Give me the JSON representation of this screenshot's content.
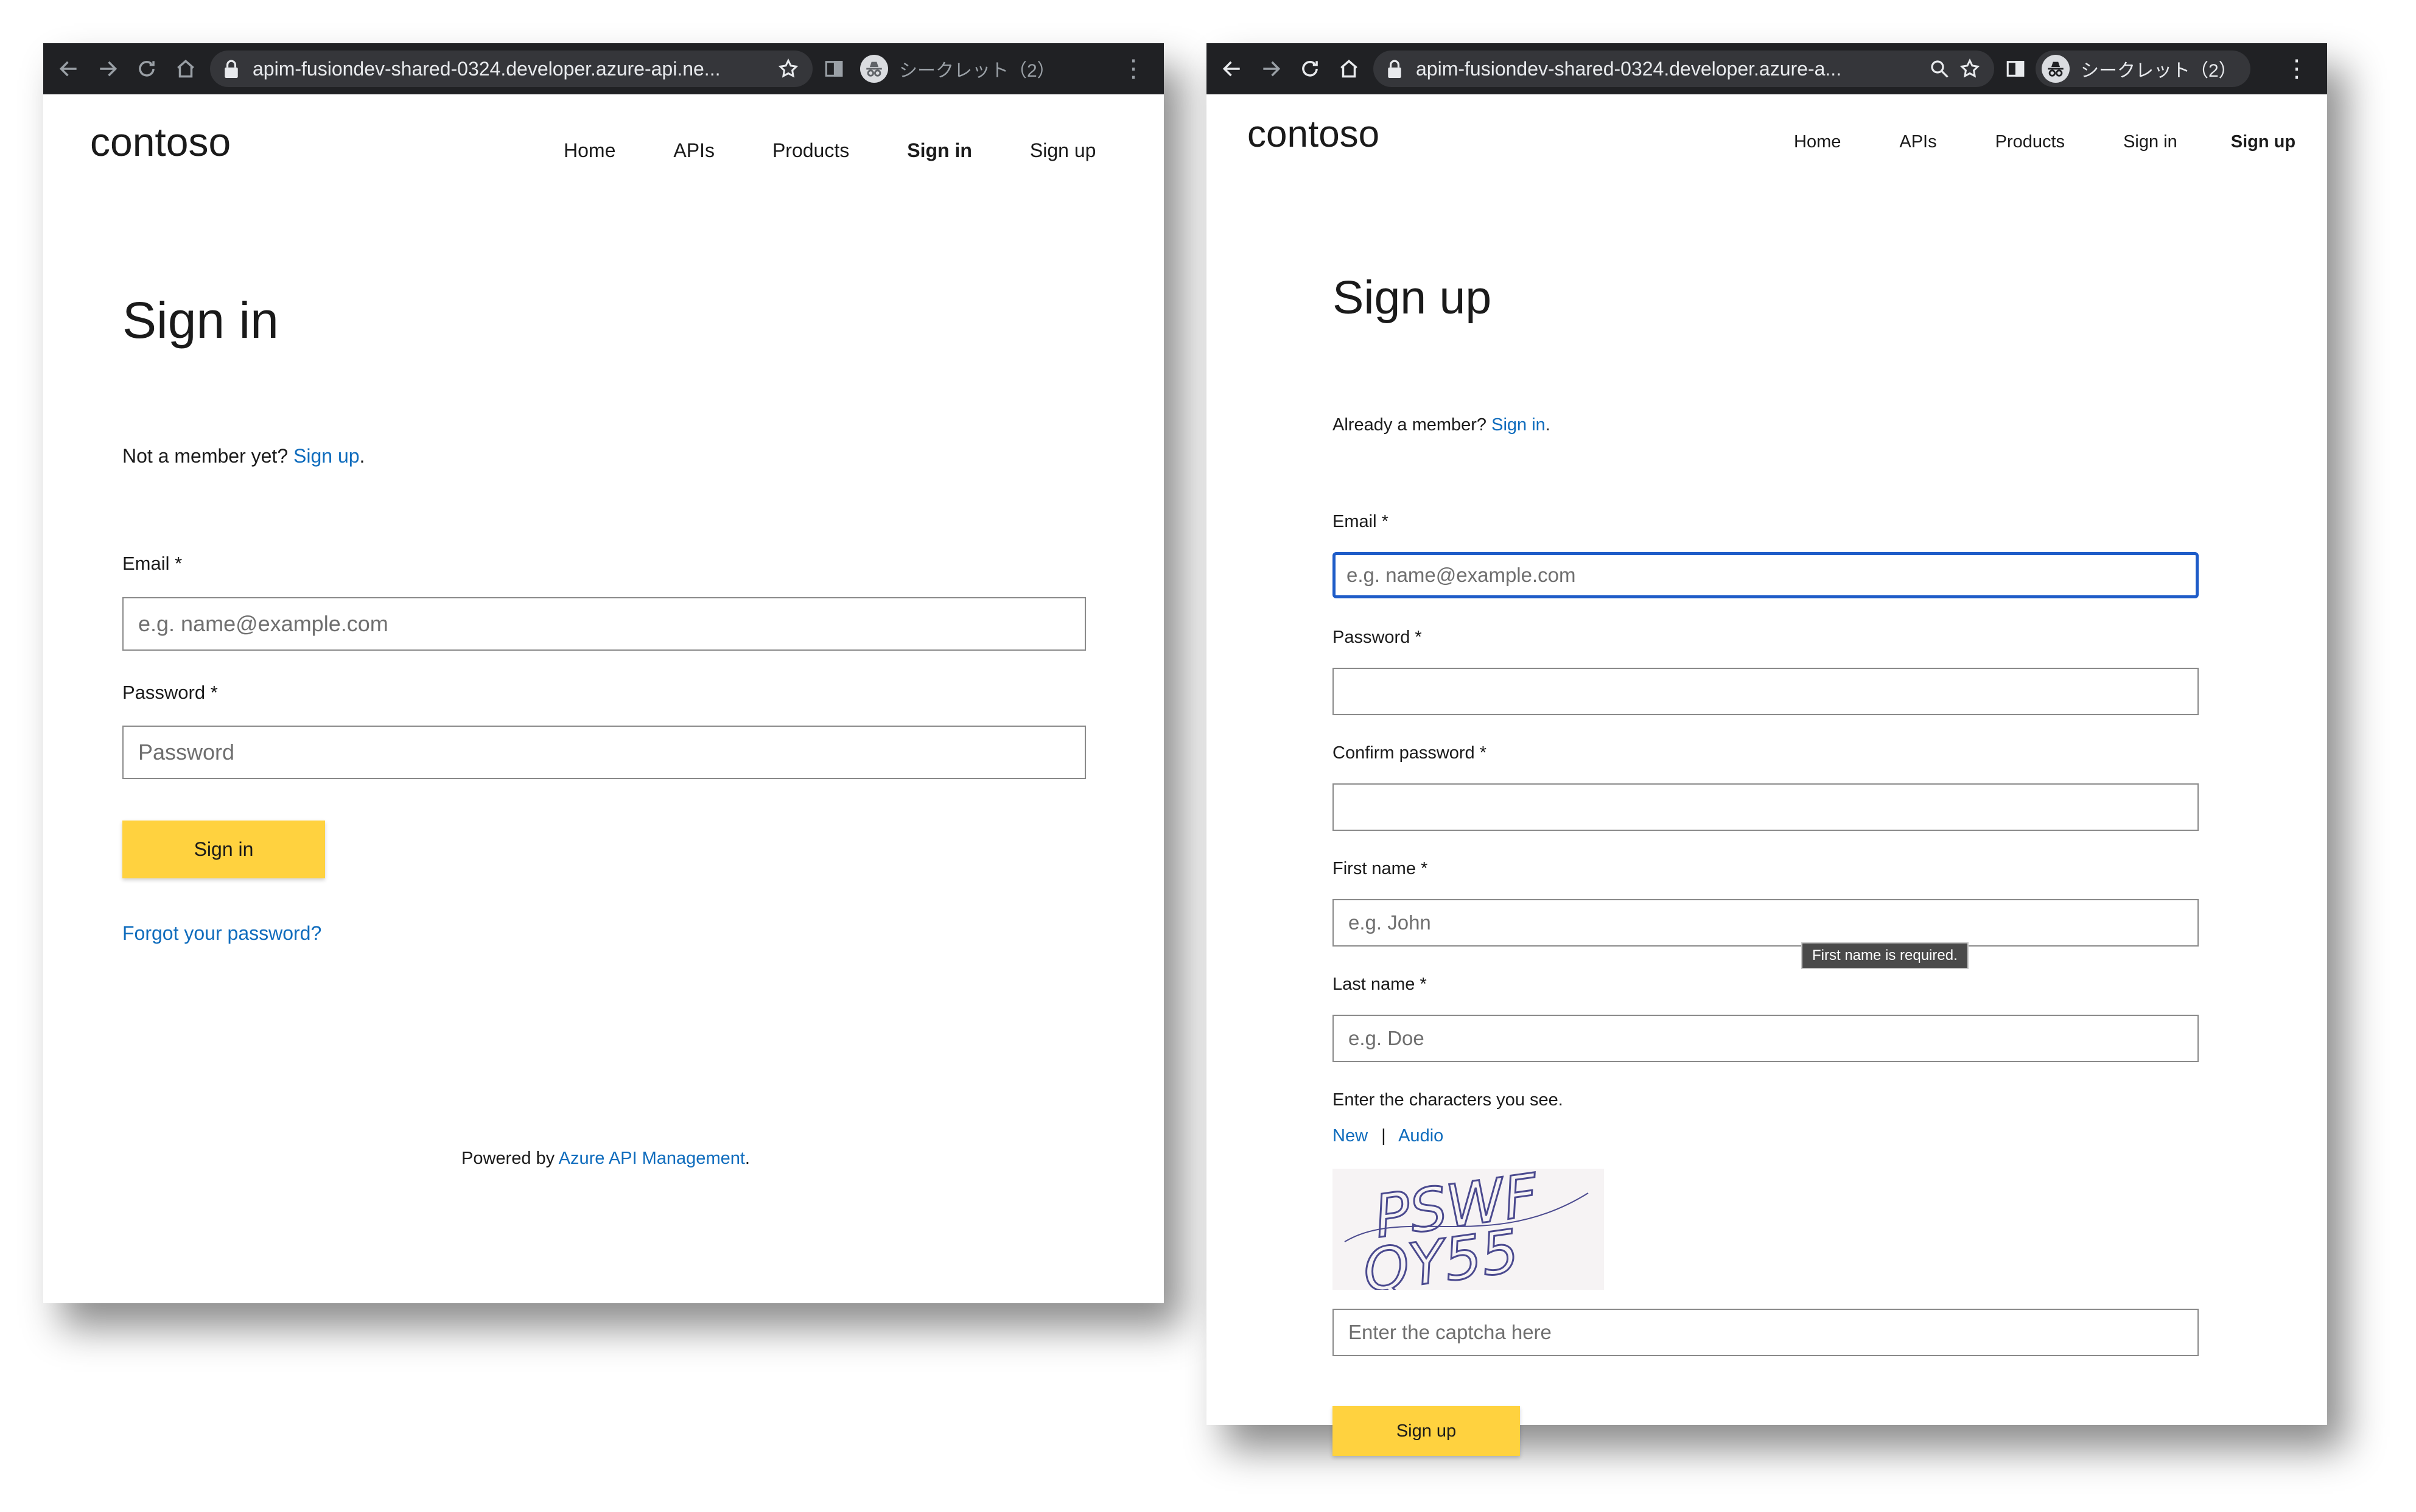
{
  "left": {
    "browser": {
      "url": "apim-fusiondev-shared-0324.developer.azure-api.ne...",
      "incognito_label": "シークレット（2）"
    },
    "logo": "contoso",
    "nav": {
      "home": "Home",
      "apis": "APIs",
      "products": "Products",
      "sign_in": "Sign in",
      "sign_up": "Sign up",
      "active": "Sign in"
    },
    "title": "Sign in",
    "not_member": "Not a member yet?",
    "sign_up_link": "Sign up",
    "period": ".",
    "email_label": "Email *",
    "email_placeholder": "e.g. name@example.com",
    "password_label": "Password *",
    "password_placeholder": "Password",
    "sign_in_button": "Sign in",
    "forgot_link": "Forgot your password?",
    "powered_by": "Powered by",
    "powered_link": "Azure API Management",
    "powered_period": "."
  },
  "right": {
    "browser": {
      "url": "apim-fusiondev-shared-0324.developer.azure-a...",
      "incognito_label": "シークレット（2）"
    },
    "logo": "contoso",
    "nav": {
      "home": "Home",
      "apis": "APIs",
      "products": "Products",
      "sign_in": "Sign in",
      "sign_up": "Sign up",
      "active": "Sign up"
    },
    "title": "Sign up",
    "already_member": "Already a member?",
    "sign_in_link": "Sign in",
    "period": ".",
    "email_label": "Email *",
    "email_placeholder": "e.g. name@example.com",
    "password_label": "Password *",
    "confirm_label": "Confirm password *",
    "first_name_label": "First name *",
    "first_name_placeholder": "e.g. John",
    "tooltip": "First name is required.",
    "last_name_label": "Last name *",
    "last_name_placeholder": "e.g. Doe",
    "captcha_prompt": "Enter the characters you see.",
    "captcha_new": "New",
    "captcha_sep": "|",
    "captcha_audio": "Audio",
    "captcha_text": "PSWF QY55",
    "captcha_placeholder": "Enter the captcha here",
    "sign_up_button": "Sign up"
  },
  "colors": {
    "link": "#0f6cbd",
    "button": "#ffd23f",
    "chrome_bg": "#202124",
    "focus": "#1e5cc8"
  }
}
